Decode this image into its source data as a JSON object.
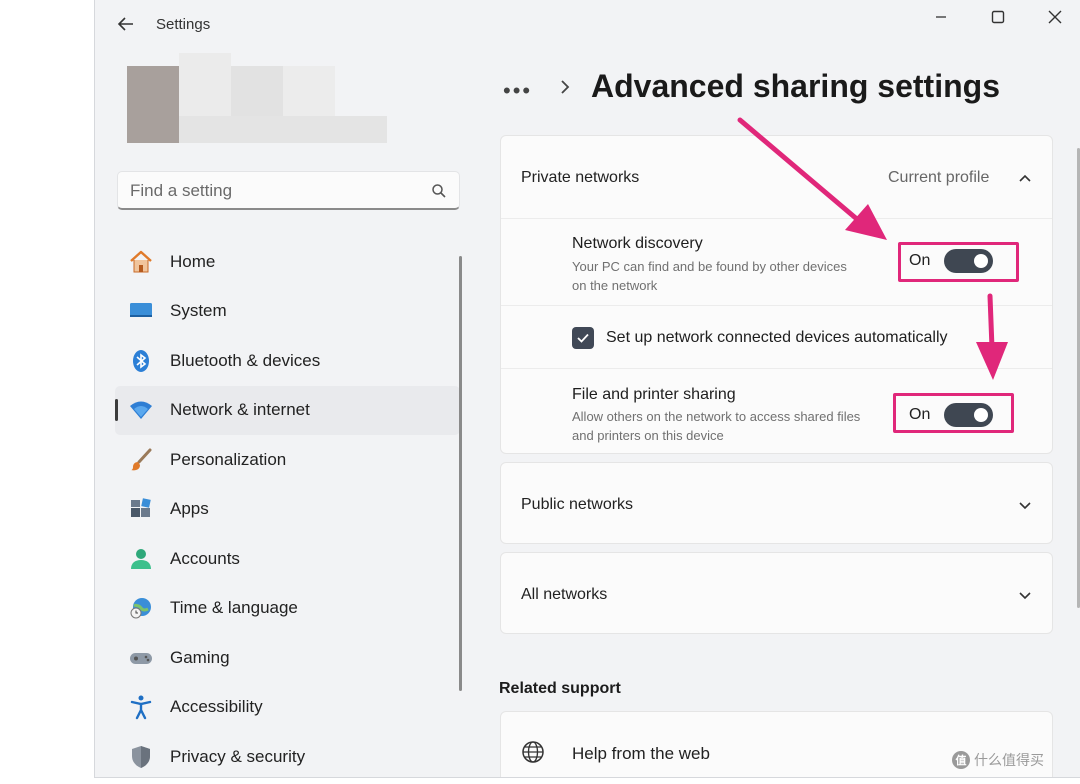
{
  "window": {
    "title": "Settings"
  },
  "search": {
    "placeholder": "Find a setting"
  },
  "nav": {
    "items": [
      {
        "label": "Home",
        "icon": "home-icon"
      },
      {
        "label": "System",
        "icon": "system-icon"
      },
      {
        "label": "Bluetooth & devices",
        "icon": "bluetooth-icon"
      },
      {
        "label": "Network & internet",
        "icon": "wifi-icon",
        "active": true
      },
      {
        "label": "Personalization",
        "icon": "brush-icon"
      },
      {
        "label": "Apps",
        "icon": "apps-icon"
      },
      {
        "label": "Accounts",
        "icon": "person-icon"
      },
      {
        "label": "Time & language",
        "icon": "globe-clock-icon"
      },
      {
        "label": "Gaming",
        "icon": "gamepad-icon"
      },
      {
        "label": "Accessibility",
        "icon": "accessibility-icon"
      },
      {
        "label": "Privacy & security",
        "icon": "shield-icon"
      }
    ]
  },
  "breadcrumb": {
    "overflow": "•••"
  },
  "page": {
    "title": "Advanced sharing settings"
  },
  "private_networks": {
    "title": "Private networks",
    "meta": "Current profile",
    "network_discovery": {
      "title": "Network discovery",
      "desc": "Your PC can find and be found by other devices on the network",
      "toggle_label": "On",
      "toggle_on": true
    },
    "auto_setup": {
      "label": "Set up network connected devices automatically",
      "checked": true
    },
    "file_sharing": {
      "title": "File and printer sharing",
      "desc": "Allow others on the network to access shared files and printers on this device",
      "toggle_label": "On",
      "toggle_on": true
    }
  },
  "public_networks": {
    "title": "Public networks"
  },
  "all_networks": {
    "title": "All networks"
  },
  "related": {
    "title": "Related support",
    "help": {
      "label": "Help from the web"
    }
  },
  "watermark": {
    "text": "什么值得买",
    "logo": "值"
  },
  "colors": {
    "accent": "#e0277a",
    "toggle": "#3f4752",
    "window_bg": "#f2f3f5"
  }
}
